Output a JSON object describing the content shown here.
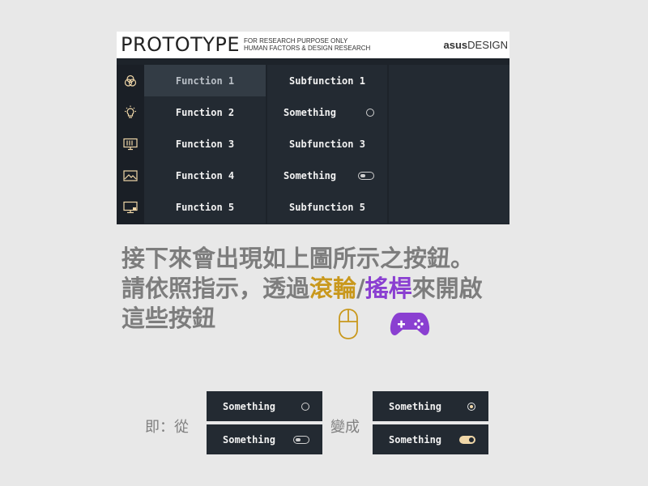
{
  "header": {
    "title": "PROTOTYPE",
    "subtitle_line1": "FOR RESEARCH PURPOSE ONLY",
    "subtitle_line2": "HUMAN FACTORS & DESIGN RESEARCH",
    "brand_bold": "asus",
    "brand_rest": "DESIGN"
  },
  "sidebar": {
    "icons": [
      "circles-icon",
      "lightbulb-icon",
      "monitor-stand-icon",
      "image-icon",
      "desktop-icon"
    ]
  },
  "functions": [
    {
      "label": "Function 1",
      "selected": true
    },
    {
      "label": "Function 2"
    },
    {
      "label": "Function 3"
    },
    {
      "label": "Function 4"
    },
    {
      "label": "Function 5"
    }
  ],
  "subfunctions": [
    {
      "label": "Subfunction 1",
      "control": "none"
    },
    {
      "label": "Something",
      "control": "radio-off"
    },
    {
      "label": "Subfunction 3",
      "control": "none"
    },
    {
      "label": "Something",
      "control": "toggle-off"
    },
    {
      "label": "Subfunction 5",
      "control": "none"
    }
  ],
  "instructions": {
    "line1": "接下來會出現如上圖所示之按鈕。",
    "line2_prefix": "請依照指示，透過",
    "wheel": "滾輪",
    "slash": "/",
    "stick": "搖桿",
    "line2_suffix": "來開啟",
    "line3": "這些按鈕"
  },
  "demo": {
    "from_label": "即：從",
    "to_label": "變成",
    "before": [
      {
        "label": "Something",
        "control": "radio-off"
      },
      {
        "label": "Something",
        "control": "toggle-off"
      }
    ],
    "after": [
      {
        "label": "Something",
        "control": "radio-on"
      },
      {
        "label": "Something",
        "control": "toggle-on"
      }
    ]
  },
  "colors": {
    "panel_bg": "#1d232a",
    "wheel_accent": "#c9981c",
    "stick_accent": "#8a3fd1",
    "active_accent": "#f0d7a8"
  }
}
